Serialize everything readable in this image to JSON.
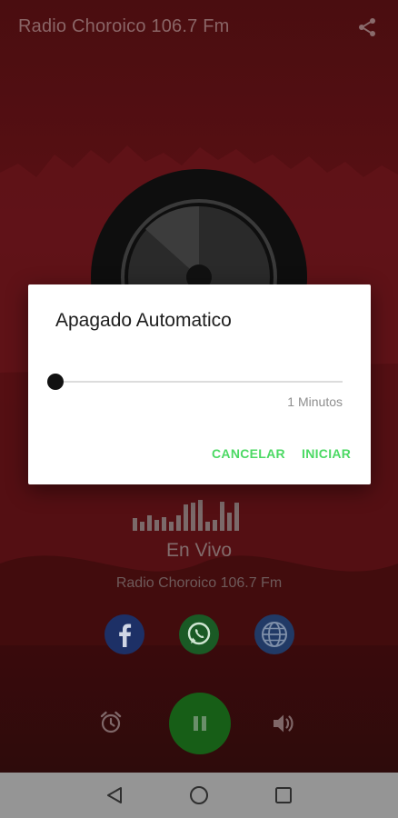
{
  "app": {
    "title": "Radio Choroico 106.7 Fm"
  },
  "player": {
    "status_label": "En Vivo",
    "station_name": "Radio Choroico 106.7 Fm",
    "bar_levels": [
      0.4,
      0.3,
      0.5,
      0.35,
      0.45,
      0.3,
      0.5,
      0.85,
      0.9,
      1.0,
      0.3,
      0.35,
      0.95,
      0.6,
      0.9
    ]
  },
  "social": {
    "items": [
      "facebook-icon",
      "whatsapp-icon",
      "globe-icon"
    ]
  },
  "dialog": {
    "title": "Apagado Automatico",
    "slider_value": 1,
    "slider_fraction": 0.0,
    "slider_label": "1 Minutos",
    "cancel_label": "CANCELAR",
    "start_label": "INICIAR"
  },
  "colors": {
    "accent_green": "#4cd964",
    "play_green": "#1a7a1a",
    "background_red": "#8b1a1f"
  }
}
